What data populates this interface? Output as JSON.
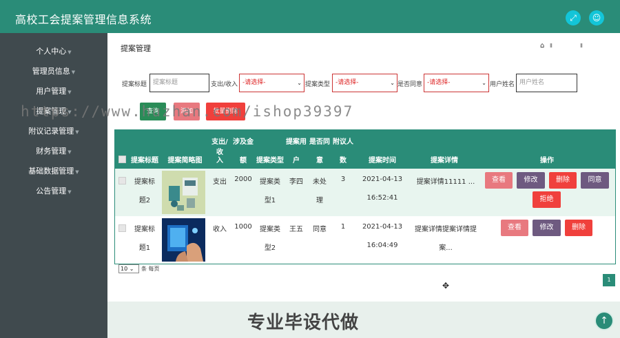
{
  "header": {
    "title": "高校工会提案管理信息系统",
    "fullscreen_icon": "expand-icon",
    "user_icon": "user-icon"
  },
  "sidebar": {
    "items": [
      {
        "label": "个人中心"
      },
      {
        "label": "管理员信息"
      },
      {
        "label": "用户管理"
      },
      {
        "label": "提案管理"
      },
      {
        "label": "附议记录管理"
      },
      {
        "label": "财务管理"
      },
      {
        "label": "基础数据管理"
      },
      {
        "label": "公告管理"
      }
    ]
  },
  "page": {
    "title": "提案管理",
    "breadcrumb_sep": "Ⅱ"
  },
  "filters": {
    "title_label": "提案标题",
    "title_placeholder": "提案标题",
    "income_label": "支出/收入",
    "income_value": "-请选择-",
    "type_label": "提案类型",
    "type_value": "-请选择-",
    "agree_label": "是否同意",
    "agree_value": "-请选择-",
    "user_label": "用户姓名",
    "user_placeholder": "用户姓名"
  },
  "toolbar": {
    "search_label": "查询",
    "add_label": "添加",
    "batch_delete_label": "批量删除"
  },
  "table": {
    "headers": {
      "title": "提案标题",
      "thumb": "提案简略图",
      "in_out_top": "支出/收",
      "in_out_bottom": "入",
      "amount_top": "涉及金",
      "amount_bottom": "额",
      "type": "提案类型",
      "user_top": "提案用",
      "user_bottom": "户",
      "agree_top": "是否同",
      "agree_bottom": "意",
      "seconds_top": "附议人",
      "seconds_bottom": "数",
      "time": "提案时间",
      "detail": "提案详情",
      "ops": "操作"
    },
    "rows": [
      {
        "title_l1": "提案标",
        "title_l2": "题2",
        "in_out": "支出",
        "amount": "2000",
        "type_l1": "提案类",
        "type_l2": "型1",
        "user": "李四",
        "agree_l1": "未处",
        "agree_l2": "理",
        "seconds": "3",
        "date": "2021-04-13",
        "time": "16:52:41",
        "detail": "提案详情11111 ...",
        "actions": [
          "查看",
          "修改",
          "删除",
          "同意",
          "拒绝"
        ]
      },
      {
        "title_l1": "提案标",
        "title_l2": "题1",
        "in_out": "收入",
        "amount": "1000",
        "type_l1": "提案类",
        "type_l2": "型2",
        "user": "王五",
        "agree_l1": "同意",
        "agree_l2": "",
        "seconds": "1",
        "date": "2021-04-13",
        "time": "16:04:49",
        "detail_l1": "提案详情提案详情提",
        "detail_l2": "案...",
        "actions": [
          "查看",
          "修改",
          "删除"
        ]
      }
    ]
  },
  "pagination": {
    "page_size": "10",
    "page_size_label": "条 每页",
    "current_page": "1"
  },
  "footer": {
    "banner": "专业毕设代做"
  },
  "watermark": "https://www.huzhan.com/ishop39397",
  "colors": {
    "primary": "#2a8c78",
    "sidebar": "#404a4e",
    "view": "#e8797f",
    "edit": "#6e5a80",
    "delete": "#f0403c",
    "agree": "#6e5a80",
    "reject": "#f0403c"
  }
}
